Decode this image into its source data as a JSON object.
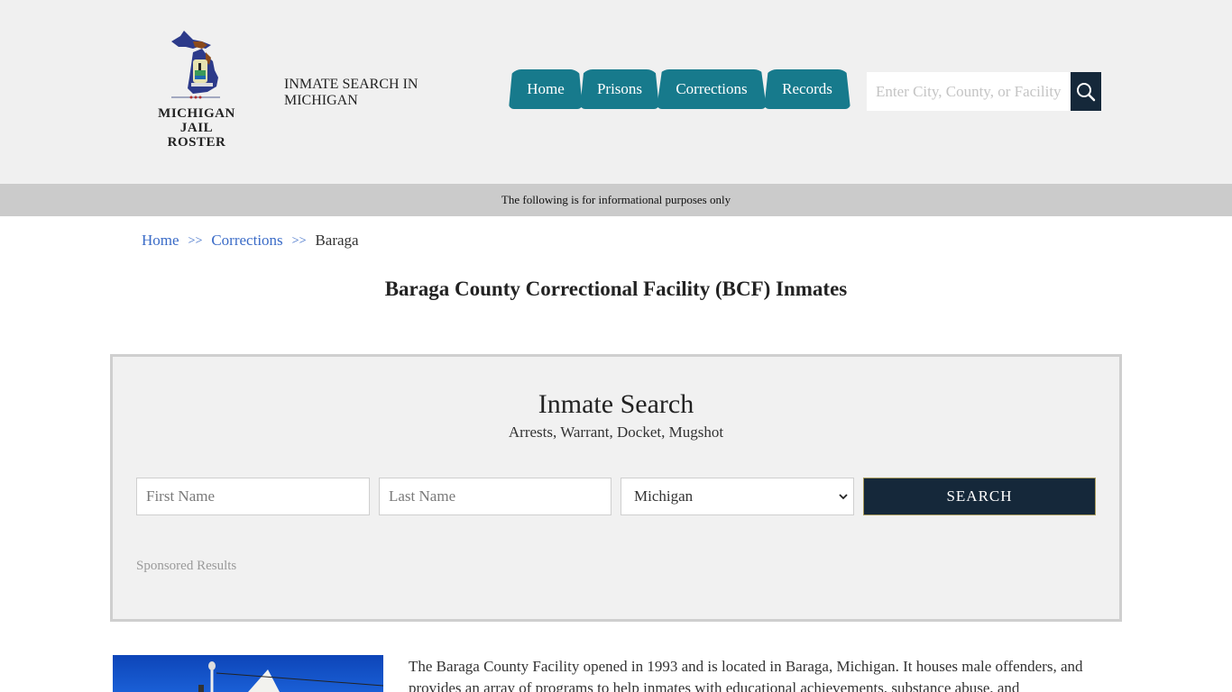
{
  "header": {
    "logo_text_line1": "MICHIGAN",
    "logo_text_line2": "JAIL ROSTER",
    "tagline": "INMATE SEARCH IN MICHIGAN",
    "nav": [
      {
        "label": "Home"
      },
      {
        "label": "Prisons"
      },
      {
        "label": "Corrections"
      },
      {
        "label": "Records"
      }
    ],
    "search": {
      "placeholder": "Enter City, County, or Facility",
      "value": "",
      "icon": "search-icon"
    }
  },
  "notice": "The following is for informational purposes only",
  "breadcrumb": {
    "items": [
      {
        "label": "Home"
      },
      {
        "label": "Corrections"
      }
    ],
    "separator": ">>",
    "current": "Baraga"
  },
  "page_title": "Baraga County Correctional Facility (BCF) Inmates",
  "inmate_search": {
    "title": "Inmate Search",
    "subtitle": "Arrests, Warrant, Docket, Mugshot",
    "first_name_placeholder": "First Name",
    "last_name_placeholder": "Last Name",
    "state_selected": "Michigan",
    "button_label": "SEARCH",
    "sponsored": "Sponsored Results"
  },
  "facility": {
    "description": "The Baraga County Facility opened in 1993 and is located in Baraga, Michigan. It houses male offenders, and provides an array of programs to help inmates with educational achievements, substance abuse, and"
  },
  "colors": {
    "nav_bg": "#177a8c",
    "dark_navy": "#15283a",
    "link_blue": "#3a6bc7",
    "header_bg": "#f0f0f0",
    "notice_bg": "#cbcbcb"
  }
}
